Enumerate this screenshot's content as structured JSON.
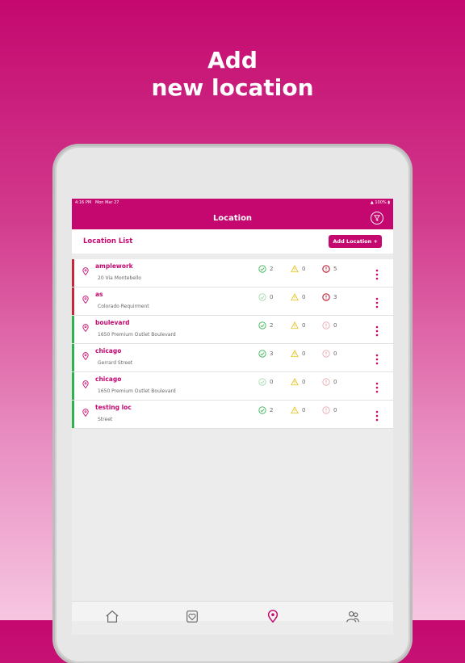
{
  "promo": {
    "line1": "Add",
    "line2": "new location"
  },
  "statusbar": {
    "time": "4:16 PM",
    "date": "Mon Mar 27",
    "battery": "100%"
  },
  "appbar": {
    "title": "Location"
  },
  "list": {
    "title": "Location List",
    "add_label": "Add Location +"
  },
  "colors": {
    "brand": "#c4086f",
    "ok": "#2fb14d",
    "warn": "#e2c21a",
    "error": "#c4263a",
    "muted": "#bdbdbd"
  },
  "locations": [
    {
      "name": "amplework",
      "address": "20 Via Montebello",
      "ok": "2",
      "warn": "0",
      "err": "5",
      "status": "error",
      "ok_active": true,
      "warn_active": true,
      "err_active": true
    },
    {
      "name": "as",
      "address": "Colorado Requirment",
      "ok": "0",
      "warn": "0",
      "err": "3",
      "status": "error",
      "ok_active": false,
      "warn_active": true,
      "err_active": true
    },
    {
      "name": "boulevard",
      "address": "1650 Premium Outlet Boulevard",
      "ok": "2",
      "warn": "0",
      "err": "0",
      "status": "ok",
      "ok_active": true,
      "warn_active": true,
      "err_active": false
    },
    {
      "name": "chicago",
      "address": "Gerrard Street",
      "ok": "3",
      "warn": "0",
      "err": "0",
      "status": "ok",
      "ok_active": true,
      "warn_active": true,
      "err_active": false
    },
    {
      "name": "chicago",
      "address": "1650 Premium Outlet Boulevard",
      "ok": "0",
      "warn": "0",
      "err": "0",
      "status": "ok",
      "ok_active": false,
      "warn_active": true,
      "err_active": false
    },
    {
      "name": "testing loc",
      "address": "Street",
      "ok": "2",
      "warn": "0",
      "err": "0",
      "status": "ok",
      "ok_active": true,
      "warn_active": true,
      "err_active": false
    }
  ],
  "tabs": [
    "home-icon",
    "health-icon",
    "location-icon",
    "users-icon"
  ]
}
